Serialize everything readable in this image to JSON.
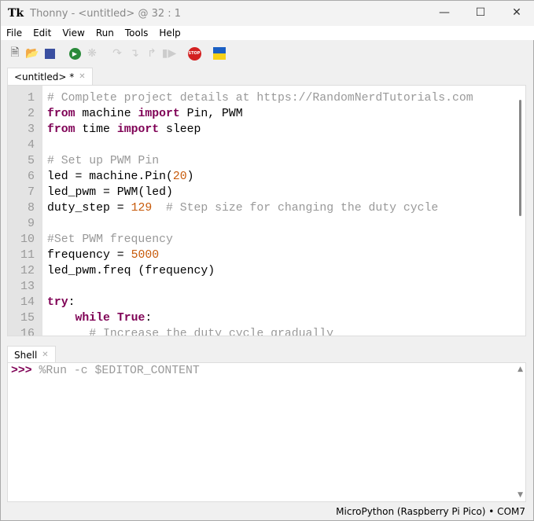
{
  "window": {
    "app_icon": "thonny-logo",
    "title": "Thonny  -  <untitled>  @  32 : 1",
    "controls": [
      "minimize",
      "maximize",
      "close"
    ]
  },
  "menu": [
    "File",
    "Edit",
    "View",
    "Run",
    "Tools",
    "Help"
  ],
  "toolbar": [
    "new-file-icon",
    "open-file-icon",
    "save-icon",
    "run-icon",
    "debug-icon",
    "step-over-icon",
    "step-into-icon",
    "step-out-icon",
    "resume-icon",
    "stop-icon",
    "ukraine-flag-icon"
  ],
  "editor": {
    "tab_label": "<untitled> *",
    "lines": [
      {
        "n": "1",
        "code": "# Complete project details at https://RandomNerdTutorials.com"
      },
      {
        "n": "2",
        "code": "from machine import Pin, PWM"
      },
      {
        "n": "3",
        "code": "from time import sleep"
      },
      {
        "n": "4",
        "code": ""
      },
      {
        "n": "5",
        "code": "# Set up PWM Pin"
      },
      {
        "n": "6",
        "code": "led = machine.Pin(20)"
      },
      {
        "n": "7",
        "code": "led_pwm = PWM(led)"
      },
      {
        "n": "8",
        "code": "duty_step = 129  # Step size for changing the duty cycle"
      },
      {
        "n": "9",
        "code": ""
      },
      {
        "n": "10",
        "code": "#Set PWM frequency"
      },
      {
        "n": "11",
        "code": "frequency = 5000"
      },
      {
        "n": "12",
        "code": "led_pwm.freq (frequency)"
      },
      {
        "n": "13",
        "code": ""
      },
      {
        "n": "14",
        "code": "try:"
      },
      {
        "n": "15",
        "code": "    while True:"
      },
      {
        "n": "16",
        "code": "      # Increase the duty cycle gradually"
      }
    ]
  },
  "shell": {
    "tab_label": "Shell",
    "prompt": ">>>",
    "command": " %Run -c $EDITOR_CONTENT"
  },
  "status": "MicroPython (Raspberry Pi Pico)  •  COM7"
}
